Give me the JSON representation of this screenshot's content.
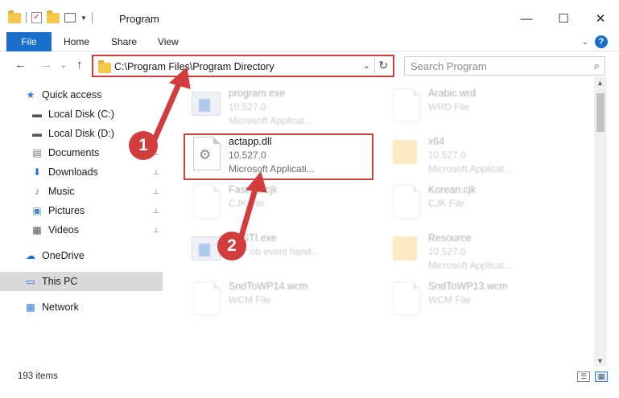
{
  "window": {
    "title": "Program",
    "minimize": "—",
    "maximize": "☐",
    "close": "✕"
  },
  "ribbon": {
    "tabs": [
      "File",
      "Home",
      "Share",
      "View"
    ],
    "help": "?",
    "collapse": "⌄"
  },
  "nav": {
    "back": "←",
    "forward": "→",
    "recent": "⌄",
    "up": "↑",
    "address": "C:\\Program Files\\Program Directory",
    "refresh": "↻",
    "dropdown": "⌄",
    "search_placeholder": "Search Program",
    "search_icon": "⌕"
  },
  "sidebar": {
    "items": [
      {
        "label": "Quick access",
        "icon": "star-icon",
        "glyph": "★",
        "color": "#2d7ad6",
        "pinned": false
      },
      {
        "label": "Local Disk (C:)",
        "icon": "disk-icon",
        "glyph": "▬",
        "color": "#555555",
        "pinned": true
      },
      {
        "label": "Local Disk (D:)",
        "icon": "disk-icon",
        "glyph": "▬",
        "color": "#555555",
        "pinned": true
      },
      {
        "label": "Documents",
        "icon": "documents-icon",
        "glyph": "▤",
        "color": "#6a7b8c",
        "pinned": true
      },
      {
        "label": "Downloads",
        "icon": "download-icon",
        "glyph": "⬇",
        "color": "#1f6fcf",
        "pinned": true
      },
      {
        "label": "Music",
        "icon": "music-icon",
        "glyph": "♪",
        "color": "#2f82d9",
        "pinned": true
      },
      {
        "label": "Pictures",
        "icon": "pictures-icon",
        "glyph": "▣",
        "color": "#4a8bcf",
        "pinned": true
      },
      {
        "label": "Videos",
        "icon": "videos-icon",
        "glyph": "▦",
        "color": "#555555",
        "pinned": true
      },
      {
        "label": "OneDrive",
        "icon": "cloud-icon",
        "glyph": "☁",
        "color": "#1f6fcf",
        "pinned": false
      },
      {
        "label": "This PC",
        "icon": "computer-icon",
        "glyph": "▭",
        "color": "#2d7ad6",
        "pinned": false
      },
      {
        "label": "Network",
        "icon": "network-icon",
        "glyph": "▩",
        "color": "#2d7ad6",
        "pinned": false
      }
    ],
    "pin_glyph": "📌"
  },
  "files": [
    {
      "name": "program.exe",
      "line2": "10.527.0",
      "line3": "Microsoft Applicat...",
      "faded": true
    },
    {
      "name": "Arabic.wrd",
      "line2": "WRD File",
      "line3": "",
      "faded": true
    },
    {
      "name": "actapp.dll",
      "line2": "10.527.0",
      "line3": "Microsoft Applicati...",
      "faded": false
    },
    {
      "name": "x64",
      "line2": "10.527.0",
      "line3": "Microsoft Applicat...",
      "faded": true
    },
    {
      "name": "Fast...d.cjk",
      "line2": "CJK File",
      "line3": "",
      "faded": true
    },
    {
      "name": "Korean.cjk",
      "line2": "CJK File",
      "line3": "",
      "faded": true
    },
    {
      "name": "...ySTI.exe",
      "line2": "...ot .ob event hand...",
      "line3": "",
      "faded": true
    },
    {
      "name": "Resource",
      "line2": "10.527.0",
      "line3": "Microsoft Applicat...",
      "faded": true
    },
    {
      "name": "SndToWP14.wcm",
      "line2": "WCM File",
      "line3": "",
      "faded": true
    },
    {
      "name": "SndToWP13.wcm",
      "line2": "WCM File",
      "line3": "",
      "faded": true
    }
  ],
  "status": {
    "items_count": "193 items"
  },
  "annotations": {
    "step1": "1",
    "step2": "2",
    "color": "#d33c3c"
  }
}
